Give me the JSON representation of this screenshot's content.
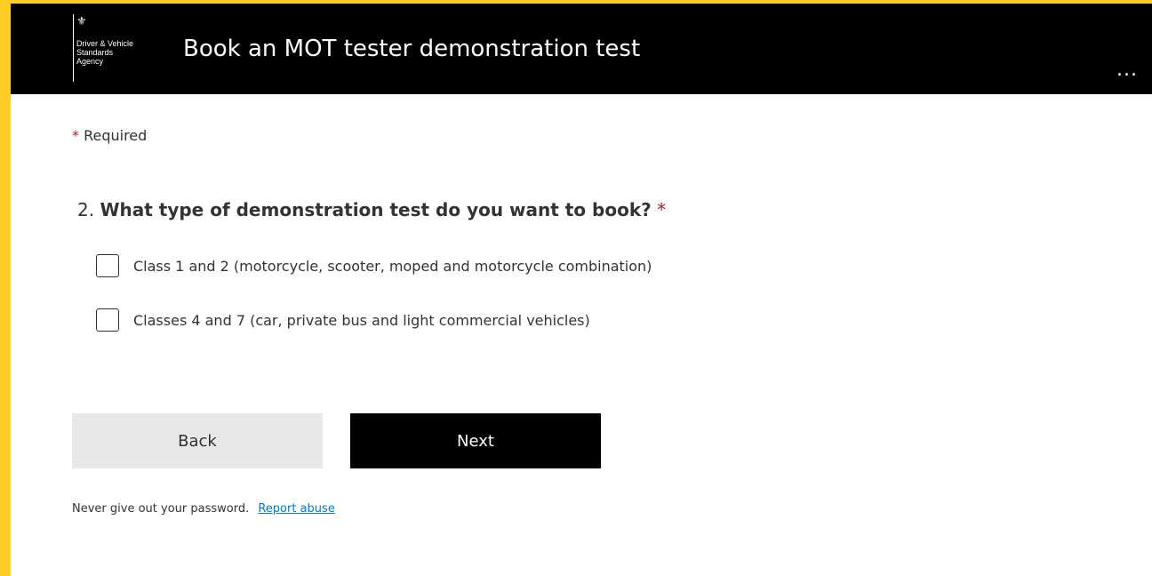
{
  "header": {
    "logo_crest": "⚜",
    "logo_lines": [
      "Driver & Vehicle",
      "Standards",
      "Agency"
    ],
    "title": "Book an MOT tester demonstration test",
    "more_label": "..."
  },
  "form": {
    "required_star": "*",
    "required_label": "Required",
    "question": {
      "number": "2.",
      "text": "What type of demonstration test do you want to book?",
      "required_star": "*"
    },
    "options": [
      {
        "label": "Class 1 and 2 (motorcycle, scooter, moped and motorcycle combination)",
        "checked": false
      },
      {
        "label": "Classes 4 and 7 (car, private bus and light commercial vehicles)",
        "checked": false
      }
    ],
    "back_label": "Back",
    "next_label": "Next"
  },
  "footer": {
    "text": "Never give out your password.",
    "link": "Report abuse"
  },
  "colors": {
    "border": "#fdcd26",
    "header_bg": "#000000",
    "required_star": "#a4262c",
    "link": "#0078d4",
    "back_button_bg": "#e8e8e8",
    "next_button_bg": "#000000"
  }
}
